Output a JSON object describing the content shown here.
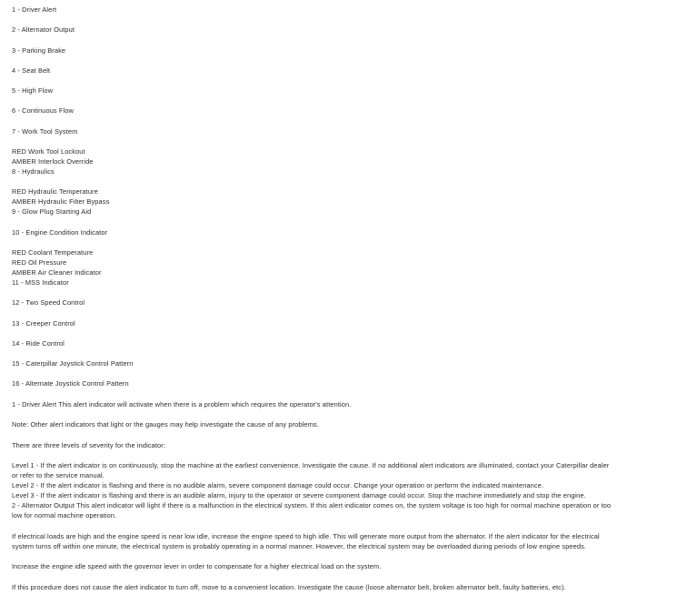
{
  "document": {
    "indicator_list": [
      {
        "label": "1 - Driver Alert"
      },
      {
        "label": "2 - Alternator Output"
      },
      {
        "label": "3 - Parking Brake"
      },
      {
        "label": "4 - Seat Belt"
      },
      {
        "label": "5 - High Flow"
      },
      {
        "label": "6 - Continuous Flow"
      },
      {
        "label": "7 - Work Tool System"
      }
    ],
    "group_work_tool": {
      "legend": [
        "RED Work Tool Lockout",
        "AMBER Interlock Override"
      ],
      "item": "8 - Hydraulics"
    },
    "group_hydraulics": {
      "legend": [
        "RED Hydraulic Temperature",
        "AMBER Hydraulic Filter Bypass"
      ],
      "item": "9 - Glow Plug Starting Aid"
    },
    "item_10": "10 - Engine Condition Indicator",
    "group_engine": {
      "legend": [
        "RED Coolant Temperature",
        "RED Oil Pressure",
        "AMBER Air Cleaner Indicator"
      ],
      "item": "11 - MSS Indicator"
    },
    "indicator_list_2": [
      {
        "label": "12 - Two Speed Control"
      },
      {
        "label": "13 - Creeper Control"
      },
      {
        "label": "14 - Ride Control"
      },
      {
        "label": "15 - Caterpillar Joystick Control Pattern"
      },
      {
        "label": "16 - Alternate Joystick Control Pattern"
      }
    ],
    "driver_alert": {
      "heading_paragraph": "1 - Driver Alert This alert indicator will activate when there is a problem which requires the operator's attention.",
      "note": "Note: Other alert indicators that light or the gauges may help investigate the cause of any problems.",
      "severity_intro": "There are three levels of severity for the indicator:",
      "levels": [
        "Level 1 - If the alert indicator is on continuously, stop the machine at the earliest convenience. Investigate the cause. If no additional alert indicators are illuminated, contact your Caterpillar dealer",
        "or refer to the service manual.",
        "Level 2 - If the alert indicator is flashing and there is no audible alarm, severe component damage could occur. Change your operation or perform the indicated maintenance.",
        "Level 3 - If the alert indicator is flashing and there is an audible alarm, injury to the operator or severe component damage could occur. Stop the machine immediately and stop the engine."
      ]
    },
    "alternator_output": {
      "lines": [
        "2 - Alternator Output This alert indicator will light if there is a malfunction in the electrical system. If this alert indicator comes on, the system voltage is too high for normal machine operation or too",
        "low for normal machine operation."
      ],
      "paragraph_1": [
        "If electrical loads are high and the engine speed is near low idle, increase the engine speed to high idle. This will generate more output from the alternator. If the alert indicator for the electrical",
        "system turns off within one minute, the electrical system is probably operating in a normal manner. However, the electrical system may be overloaded during periods of low engine speeds."
      ],
      "paragraph_2": "Increase the engine idle speed with the governor lever in order to compensate for a higher electrical load on the system.",
      "paragraph_3": "If this procedure does not cause the alert indicator to turn off, move to a convenient location. Investigate the cause (loose alternator belt, broken alternator belt, faulty batteries, etc)."
    }
  }
}
